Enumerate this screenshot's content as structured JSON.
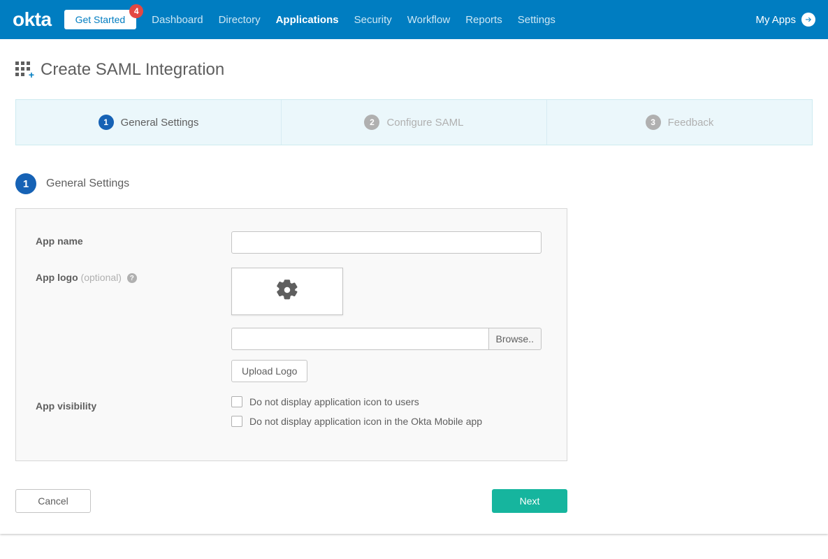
{
  "topnav": {
    "logo_text": "okta",
    "get_started_label": "Get Started",
    "badge_count": "4",
    "items": [
      "Dashboard",
      "Directory",
      "Applications",
      "Security",
      "Workflow",
      "Reports",
      "Settings"
    ],
    "active_index": 2,
    "my_apps_label": "My Apps"
  },
  "page": {
    "title": "Create SAML Integration"
  },
  "wizard": {
    "steps": [
      {
        "num": "1",
        "label": "General Settings"
      },
      {
        "num": "2",
        "label": "Configure SAML"
      },
      {
        "num": "3",
        "label": "Feedback"
      }
    ],
    "active_index": 0
  },
  "step": {
    "num": "1",
    "title": "General Settings"
  },
  "form": {
    "app_name": {
      "label": "App name",
      "value": ""
    },
    "app_logo": {
      "label": "App logo",
      "optional": "(optional)",
      "browse_label": "Browse..",
      "upload_label": "Upload Logo",
      "file_path_value": ""
    },
    "app_visibility": {
      "label": "App visibility",
      "opt1": "Do not display application icon to users",
      "opt2": "Do not display application icon in the Okta Mobile app"
    }
  },
  "footer": {
    "cancel": "Cancel",
    "next": "Next"
  }
}
